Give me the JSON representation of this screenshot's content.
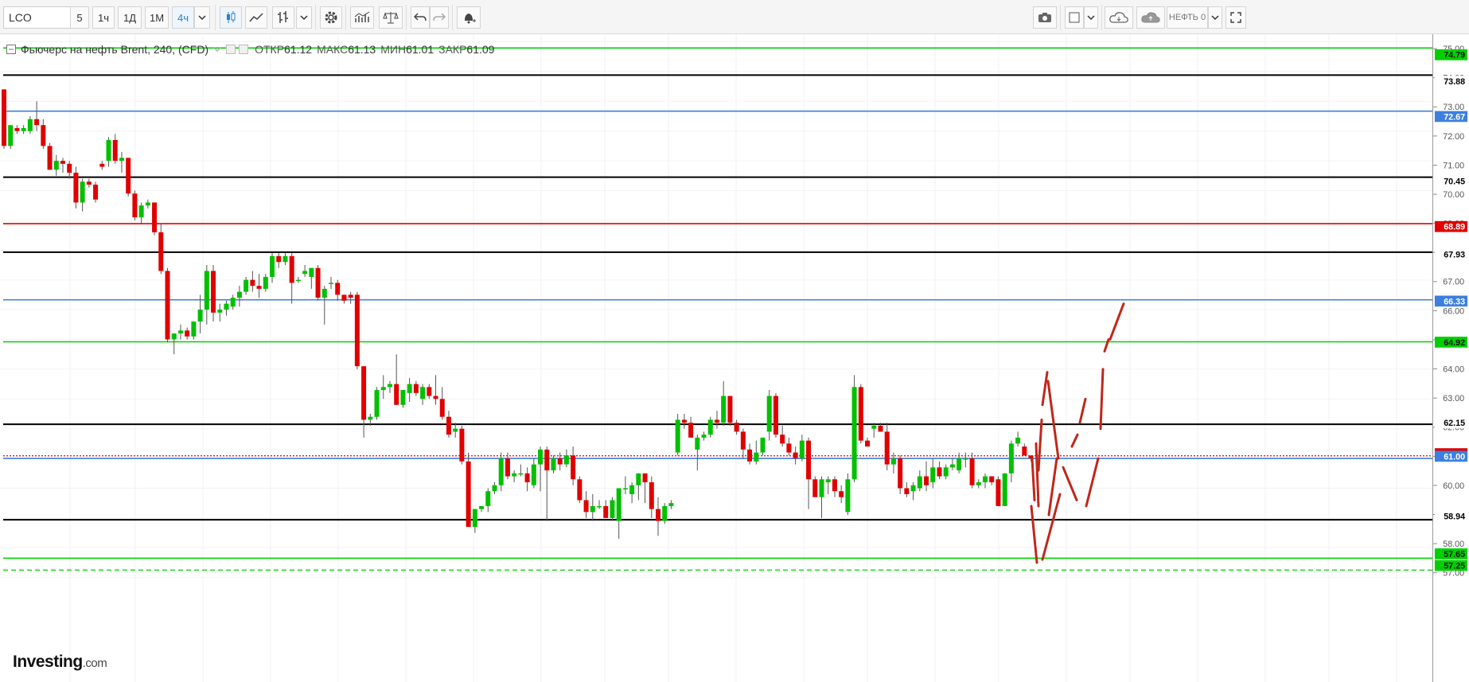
{
  "toolbar": {
    "symbol": "LCO",
    "intervals": [
      "5",
      "1ч",
      "1Д",
      "1М",
      "4ч"
    ],
    "active_interval": "4ч",
    "candle_icon": "candles-icon",
    "line_icon": "line-chart-icon",
    "bars_icon": "bars-icon",
    "dropdown_icon": "chevron-down-icon",
    "settings_icon": "gear-icon",
    "indicators_icon": "indicators-icon",
    "compare_icon": "scales-icon",
    "undo_icon": "undo-icon",
    "redo_icon": "redo-icon",
    "alert_icon": "alert-bell-icon",
    "snapshot_icon": "camera-icon",
    "layout_icon": "layout-icon",
    "cloud_load_icon": "cloud-download-icon",
    "cloud_save_icon": "cloud-upload-icon",
    "template_label": "НЕФТЬ 0",
    "fullscreen_icon": "fullscreen-icon"
  },
  "legend": {
    "title": "Фьючерс на нефть Brent, 240, (CFD)",
    "open_label": "ОТКР",
    "open_value": "61.12",
    "high_label": "МАКС",
    "high_value": "61.13",
    "low_label": "МИН",
    "low_value": "61.01",
    "close_label": "ЗАКР",
    "close_value": "61.09"
  },
  "logo": {
    "brand": "Investing",
    "suffix": ".com"
  },
  "colors": {
    "up": "#00c000",
    "down": "#e00000",
    "projection": "#c0271b",
    "green_level": "#00d000",
    "blue_level": "#3c7fe0",
    "red_level": "#e00000",
    "black_level": "#000000"
  },
  "chart_data": {
    "type": "candlestick",
    "title": "Фьючерс на нефть Brent, 240, (CFD)",
    "ylim": [
      57.0,
      75.3
    ],
    "y_ticks": [
      "75.00",
      "74.00",
      "73.00",
      "72.00",
      "71.00",
      "70.00",
      "69.00",
      "68.00",
      "67.00",
      "66.00",
      "65.00",
      "64.00",
      "63.00",
      "62.00",
      "61.00",
      "60.00",
      "59.00",
      "58.00",
      "57.00"
    ],
    "levels": [
      {
        "value": 74.79,
        "label": "74.79",
        "color": "#00d000",
        "style": "solid"
      },
      {
        "value": 73.88,
        "label": "73.88",
        "color": "#000000",
        "style": "solid"
      },
      {
        "value": 72.67,
        "label": "72.67",
        "color": "#3c7fe0",
        "style": "solid"
      },
      {
        "value": 70.45,
        "label": "70.45",
        "color": "#000000",
        "style": "solid"
      },
      {
        "value": 68.89,
        "label": "68.89",
        "color": "#e00000",
        "style": "solid"
      },
      {
        "value": 67.93,
        "label": "67.93",
        "color": "#000000",
        "style": "solid"
      },
      {
        "value": 66.33,
        "label": "66.33",
        "color": "#3c7fe0",
        "style": "solid"
      },
      {
        "value": 64.92,
        "label": "64.92",
        "color": "#00d000",
        "style": "solid"
      },
      {
        "value": 62.15,
        "label": "62.15",
        "color": "#000000",
        "style": "solid"
      },
      {
        "value": 61.09,
        "label": "61.09",
        "color": "#e00000",
        "style": "dotted"
      },
      {
        "value": 61.0,
        "label": "61.00",
        "color": "#3c7fe0",
        "style": "solid"
      },
      {
        "value": 58.94,
        "label": "58.94",
        "color": "#000000",
        "style": "solid"
      },
      {
        "value": 57.65,
        "label": "57.65",
        "color": "#00d000",
        "style": "solid"
      },
      {
        "value": 57.25,
        "label": "57.25",
        "color": "#00d000",
        "style": "dashed"
      }
    ],
    "candles": [
      [
        73.4,
        73.4,
        71.4,
        71.5
      ],
      [
        71.5,
        72.2,
        71.4,
        72.2
      ],
      [
        72.1,
        72.2,
        71.9,
        72.0
      ],
      [
        72.0,
        72.2,
        71.9,
        72.1
      ],
      [
        72.0,
        72.5,
        71.9,
        72.4
      ],
      [
        72.4,
        73.0,
        72.0,
        72.2
      ],
      [
        72.2,
        72.4,
        71.4,
        71.5
      ],
      [
        71.5,
        71.6,
        70.7,
        70.7
      ],
      [
        70.7,
        71.2,
        70.5,
        71.0
      ],
      [
        71.0,
        71.1,
        70.6,
        70.9
      ],
      [
        70.9,
        71.0,
        70.4,
        70.6
      ],
      [
        70.6,
        70.8,
        69.4,
        69.6
      ],
      [
        69.6,
        70.4,
        69.3,
        70.3
      ],
      [
        70.3,
        70.4,
        70.1,
        70.2
      ],
      [
        70.2,
        70.3,
        69.6,
        69.7
      ],
      [
        70.9,
        71.0,
        70.7,
        70.8
      ],
      [
        71.0,
        71.8,
        70.8,
        71.7
      ],
      [
        71.7,
        71.9,
        70.9,
        71.0
      ],
      [
        71.0,
        71.3,
        70.6,
        71.1
      ],
      [
        71.1,
        71.1,
        69.8,
        69.9
      ],
      [
        69.9,
        70.0,
        69.0,
        69.1
      ],
      [
        69.1,
        69.6,
        68.9,
        69.5
      ],
      [
        69.5,
        69.7,
        69.4,
        69.6
      ],
      [
        69.6,
        69.6,
        68.5,
        68.6
      ],
      [
        68.6,
        68.9,
        67.2,
        67.3
      ],
      [
        67.3,
        67.4,
        64.9,
        65.0
      ],
      [
        65.0,
        65.2,
        64.5,
        65.2
      ],
      [
        65.2,
        65.5,
        65.0,
        65.3
      ],
      [
        65.3,
        65.4,
        65.0,
        65.1
      ],
      [
        65.1,
        65.6,
        65.0,
        65.6
      ],
      [
        65.6,
        66.5,
        65.2,
        66.0
      ],
      [
        66.0,
        67.5,
        65.5,
        67.3
      ],
      [
        67.3,
        67.5,
        65.6,
        65.9
      ],
      [
        65.9,
        66.2,
        65.6,
        66.0
      ],
      [
        66.0,
        66.3,
        65.8,
        66.2
      ],
      [
        66.1,
        66.5,
        66.0,
        66.4
      ],
      [
        66.4,
        66.8,
        66.1,
        66.6
      ],
      [
        66.6,
        67.1,
        66.5,
        67.0
      ],
      [
        67.0,
        67.3,
        66.6,
        66.8
      ],
      [
        66.8,
        67.2,
        66.4,
        66.7
      ],
      [
        66.7,
        67.2,
        66.6,
        67.1
      ],
      [
        67.1,
        67.9,
        66.9,
        67.8
      ],
      [
        67.8,
        67.9,
        67.4,
        67.6
      ],
      [
        67.6,
        67.9,
        67.5,
        67.8
      ],
      [
        67.8,
        67.9,
        66.2,
        66.9
      ],
      [
        67.0,
        67.1,
        66.9,
        67.0
      ],
      [
        67.2,
        67.5,
        67.1,
        67.3
      ],
      [
        67.1,
        67.4,
        66.7,
        67.4
      ],
      [
        67.4,
        67.5,
        66.3,
        66.4
      ],
      [
        66.4,
        66.8,
        65.5,
        66.7
      ],
      [
        66.9,
        67.1,
        66.7,
        66.9
      ],
      [
        66.9,
        67.0,
        66.3,
        66.5
      ],
      [
        66.5,
        66.5,
        66.2,
        66.3
      ],
      [
        66.5,
        66.6,
        66.2,
        66.4
      ],
      [
        66.5,
        66.6,
        64.0,
        64.1
      ],
      [
        64.1,
        64.1,
        61.7,
        62.3
      ],
      [
        62.3,
        62.5,
        62.1,
        62.4
      ],
      [
        62.4,
        63.4,
        62.3,
        63.3
      ],
      [
        63.3,
        63.8,
        63.0,
        63.4
      ],
      [
        63.4,
        63.6,
        63.2,
        63.5
      ],
      [
        63.5,
        64.5,
        62.8,
        62.8
      ],
      [
        62.8,
        63.3,
        62.7,
        63.3
      ],
      [
        63.2,
        63.7,
        62.9,
        63.5
      ],
      [
        63.5,
        63.6,
        63.1,
        63.2
      ],
      [
        63.0,
        63.5,
        62.8,
        63.4
      ],
      [
        63.4,
        63.5,
        63.0,
        63.1
      ],
      [
        63.1,
        63.8,
        62.8,
        63.0
      ],
      [
        63.0,
        63.4,
        62.3,
        62.4
      ],
      [
        62.4,
        62.6,
        61.7,
        61.8
      ],
      [
        61.9,
        62.2,
        61.7,
        62.0
      ],
      [
        62.0,
        62.1,
        60.8,
        60.9
      ],
      [
        60.9,
        61.2,
        58.7,
        58.7
      ],
      [
        58.7,
        59.3,
        58.5,
        59.3
      ],
      [
        59.3,
        59.4,
        59.2,
        59.4
      ],
      [
        59.4,
        60.0,
        59.2,
        59.9
      ],
      [
        59.9,
        60.2,
        59.8,
        60.1
      ],
      [
        60.1,
        61.2,
        59.9,
        61.0
      ],
      [
        61.0,
        61.2,
        60.3,
        60.4
      ],
      [
        60.4,
        60.6,
        60.2,
        60.5
      ],
      [
        60.5,
        60.8,
        60.4,
        60.5
      ],
      [
        60.5,
        60.7,
        59.9,
        60.2
      ],
      [
        60.1,
        61.0,
        60.0,
        60.8
      ],
      [
        60.8,
        61.4,
        59.9,
        61.3
      ],
      [
        61.3,
        61.4,
        58.9,
        60.6
      ],
      [
        60.6,
        61.1,
        60.5,
        61.0
      ],
      [
        61.0,
        61.2,
        60.6,
        60.8
      ],
      [
        60.8,
        61.3,
        60.7,
        61.1
      ],
      [
        61.1,
        61.4,
        60.1,
        60.3
      ],
      [
        60.3,
        60.4,
        59.5,
        59.6
      ],
      [
        59.6,
        59.9,
        59.0,
        59.2
      ],
      [
        59.2,
        59.8,
        58.9,
        59.4
      ],
      [
        59.4,
        59.6,
        59.3,
        59.4
      ],
      [
        59.4,
        59.6,
        59.1,
        59.0
      ],
      [
        59.0,
        59.7,
        58.9,
        59.6
      ],
      [
        58.9,
        60.0,
        58.3,
        60.0
      ],
      [
        60.0,
        60.4,
        59.8,
        60.0
      ],
      [
        59.8,
        60.2,
        59.5,
        60.1
      ],
      [
        60.1,
        60.5,
        59.6,
        60.5
      ],
      [
        60.5,
        60.5,
        59.5,
        60.2
      ],
      [
        60.2,
        60.4,
        59.0,
        59.3
      ],
      [
        59.3,
        59.7,
        58.4,
        58.9
      ],
      [
        58.9,
        59.5,
        58.8,
        59.4
      ],
      [
        59.4,
        59.6,
        59.3,
        59.5
      ],
      [
        61.2,
        62.5,
        61.1,
        62.3
      ],
      [
        62.3,
        62.5,
        62.0,
        62.2
      ],
      [
        62.2,
        62.4,
        61.8,
        61.7
      ],
      [
        61.3,
        61.8,
        60.6,
        61.7
      ],
      [
        61.7,
        61.9,
        61.6,
        61.8
      ],
      [
        61.8,
        62.4,
        61.7,
        62.3
      ],
      [
        62.3,
        62.6,
        62.0,
        62.2
      ],
      [
        62.2,
        63.6,
        62.1,
        63.1
      ],
      [
        63.1,
        63.1,
        62.1,
        62.2
      ],
      [
        62.2,
        62.3,
        61.8,
        61.9
      ],
      [
        61.9,
        62.0,
        61.0,
        61.3
      ],
      [
        61.3,
        61.5,
        60.8,
        60.9
      ],
      [
        60.9,
        61.6,
        60.8,
        61.2
      ],
      [
        61.2,
        61.7,
        61.1,
        61.7
      ],
      [
        61.9,
        63.3,
        61.6,
        63.1
      ],
      [
        63.1,
        63.2,
        61.7,
        61.8
      ],
      [
        61.8,
        62.1,
        61.4,
        61.5
      ],
      [
        61.5,
        61.7,
        61.1,
        61.2
      ],
      [
        61.2,
        61.4,
        60.8,
        61.0
      ],
      [
        61.0,
        61.8,
        60.9,
        61.6
      ],
      [
        61.6,
        61.7,
        59.3,
        60.3
      ],
      [
        60.3,
        60.4,
        59.8,
        59.7
      ],
      [
        59.7,
        60.4,
        59.0,
        60.3
      ],
      [
        60.2,
        60.4,
        59.8,
        60.3
      ],
      [
        60.3,
        60.4,
        59.7,
        59.9
      ],
      [
        59.9,
        60.1,
        59.5,
        59.7
      ],
      [
        59.2,
        60.5,
        59.1,
        60.3
      ],
      [
        60.3,
        63.8,
        60.2,
        63.4
      ],
      [
        63.4,
        63.5,
        61.5,
        61.6
      ],
      [
        61.6,
        61.7,
        61.4,
        61.4
      ],
      [
        62.0,
        62.2,
        61.7,
        62.1
      ],
      [
        62.1,
        62.2,
        61.9,
        61.9
      ],
      [
        61.9,
        62.2,
        60.6,
        60.8
      ],
      [
        60.8,
        61.2,
        60.5,
        61.0
      ],
      [
        61.0,
        61.1,
        59.8,
        60.0
      ],
      [
        60.0,
        60.2,
        59.7,
        59.8
      ],
      [
        59.9,
        60.2,
        59.6,
        60.1
      ],
      [
        60.0,
        60.6,
        59.9,
        60.4
      ],
      [
        60.4,
        60.9,
        59.9,
        60.1
      ],
      [
        60.2,
        61.0,
        60.0,
        60.7
      ],
      [
        60.7,
        60.9,
        60.3,
        60.4
      ],
      [
        60.4,
        60.8,
        60.3,
        60.7
      ],
      [
        60.7,
        61.0,
        60.6,
        60.8
      ],
      [
        60.6,
        61.2,
        60.5,
        61.0
      ],
      [
        61.0,
        61.2,
        60.7,
        61.0
      ],
      [
        61.0,
        61.2,
        60.0,
        60.1
      ],
      [
        60.1,
        60.3,
        60.0,
        60.2
      ],
      [
        60.2,
        60.5,
        60.0,
        60.4
      ],
      [
        60.4,
        60.4,
        60.1,
        60.2
      ],
      [
        60.3,
        60.4,
        59.4,
        59.4
      ],
      [
        59.4,
        60.5,
        59.4,
        60.5
      ],
      [
        60.5,
        61.6,
        60.2,
        61.5
      ],
      [
        61.5,
        61.9,
        61.4,
        61.7
      ],
      [
        61.4,
        61.5,
        61.1,
        61.1
      ],
      [
        61.1,
        61.1,
        60.9,
        61.0
      ]
    ],
    "projection_segments": [
      [
        [
          1297,
          61.0
        ],
        [
          1300,
          59.6
        ]
      ],
      [
        [
          1302,
          61.5
        ],
        [
          1305,
          59.4
        ]
      ],
      [
        [
          1305,
          60.6
        ],
        [
          1309,
          62.3
        ]
      ],
      [
        [
          1310,
          62.8
        ],
        [
          1316,
          63.9
        ]
      ],
      [
        [
          1317,
          63.6
        ],
        [
          1330,
          61.0
        ]
      ],
      [
        [
          1336,
          60.7
        ],
        [
          1353,
          59.6
        ]
      ],
      [
        [
          1296,
          59.4
        ],
        [
          1303,
          57.5
        ]
      ],
      [
        [
          1310,
          57.6
        ],
        [
          1332,
          59.8
        ]
      ],
      [
        [
          1318,
          59.1
        ],
        [
          1328,
          61.0
        ]
      ],
      [
        [
          1347,
          61.4
        ],
        [
          1354,
          61.8
        ]
      ],
      [
        [
          1357,
          62.2
        ],
        [
          1364,
          63.0
        ]
      ],
      [
        [
          1365,
          59.4
        ],
        [
          1380,
          61.0
        ]
      ],
      [
        [
          1383,
          62.0
        ],
        [
          1386,
          64.0
        ]
      ],
      [
        [
          1388,
          64.6
        ],
        [
          1393,
          65.0
        ]
      ],
      [
        [
          1395,
          65.0
        ],
        [
          1412,
          66.2
        ]
      ]
    ]
  }
}
